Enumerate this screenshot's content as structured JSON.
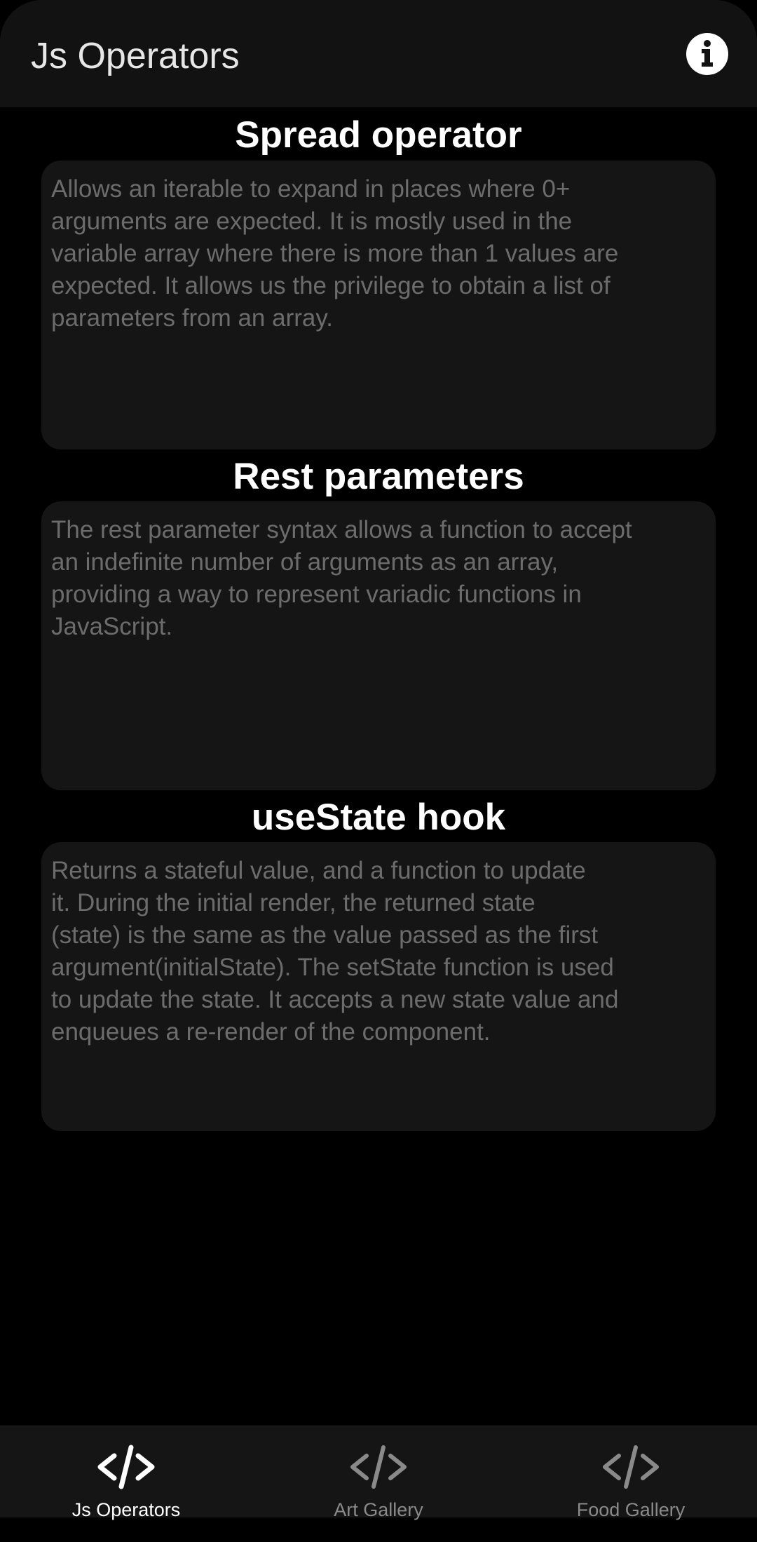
{
  "app": {
    "title": "Js Operators"
  },
  "sections": [
    {
      "title": "Spread operator",
      "body": "Allows an iterable to expand in places where 0+\narguments are expected. It is mostly used in the\nvariable array where there is more than 1 values are\nexpected. It allows us the privilege to obtain a list of\nparameters from an array."
    },
    {
      "title": "Rest parameters",
      "body": "The rest parameter syntax allows a function to accept\nan indefinite number of arguments as an array,\nproviding a way to represent variadic functions in\nJavaScript."
    },
    {
      "title": "useState hook",
      "body": "Returns a stateful value, and a function to update\nit. During the initial render, the returned state\n(state) is the same as the value passed as the first\nargument(initialState). The setState function is used\nto update the state. It accepts a new state value and\nenqueues a re-render of the component."
    }
  ],
  "tabs": [
    {
      "label": "Js Operators",
      "icon": "code-icon",
      "active": true
    },
    {
      "label": "Art Gallery",
      "icon": "code-icon",
      "active": false
    },
    {
      "label": "Food Gallery",
      "icon": "code-icon",
      "active": false
    }
  ],
  "icons": {
    "header_action": "info-icon"
  },
  "colors": {
    "background": "#000000",
    "header": "#121212",
    "card": "#151515",
    "card_text": "#6c6c6c",
    "tab_active": "#ffffff",
    "tab_inactive": "#8a8a8a"
  }
}
